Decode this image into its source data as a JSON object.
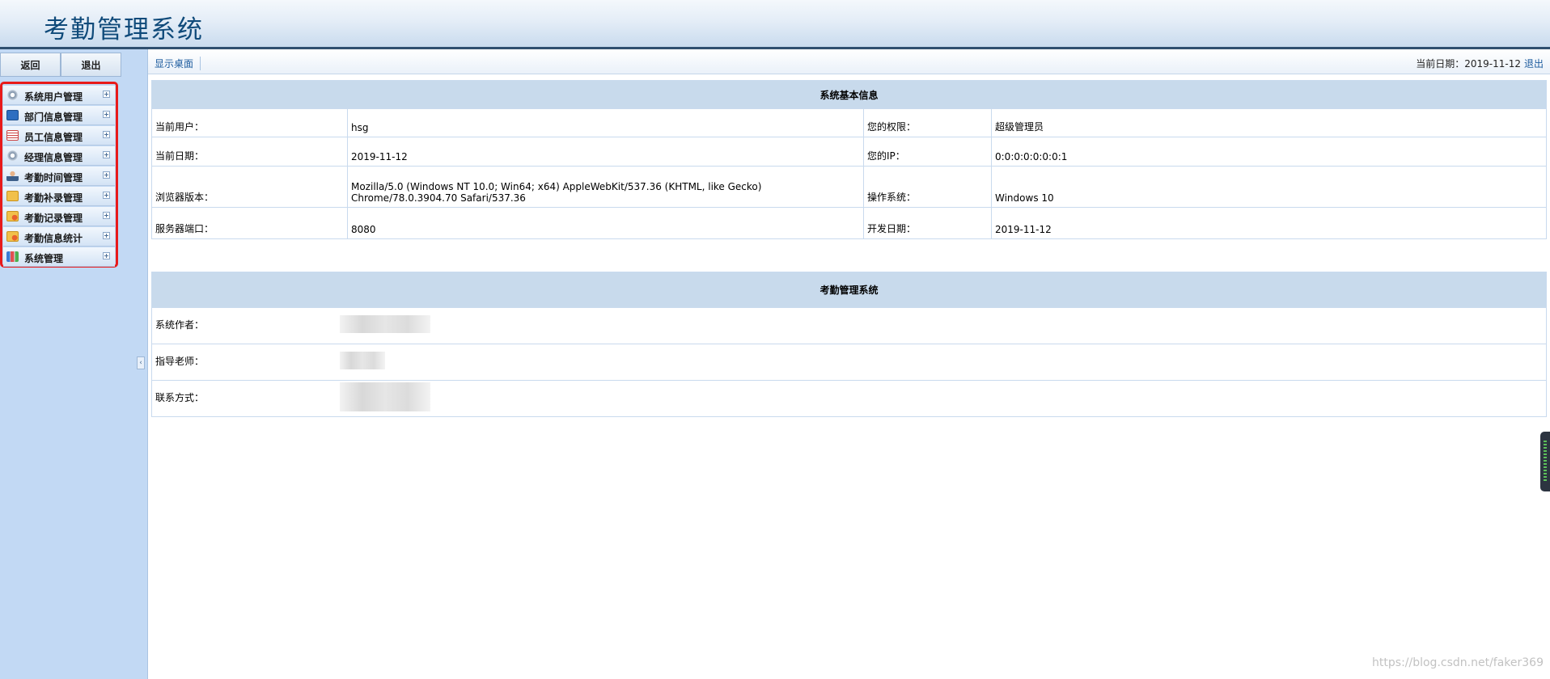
{
  "header": {
    "title": "考勤管理系统"
  },
  "sidebar": {
    "top_buttons": {
      "back": "返回",
      "exit": "退出"
    },
    "menu": [
      {
        "label": "系统用户管理",
        "icon": "gear-icon"
      },
      {
        "label": "部门信息管理",
        "icon": "monitor-icon"
      },
      {
        "label": "员工信息管理",
        "icon": "table-icon"
      },
      {
        "label": "经理信息管理",
        "icon": "gear-icon"
      },
      {
        "label": "考勤时间管理",
        "icon": "user-icon"
      },
      {
        "label": "考勤补录管理",
        "icon": "folder-icon"
      },
      {
        "label": "考勤记录管理",
        "icon": "folder-user-icon"
      },
      {
        "label": "考勤信息统计",
        "icon": "folder-user-icon"
      },
      {
        "label": "系统管理",
        "icon": "chart-icon"
      }
    ],
    "collapse_glyph": "‹"
  },
  "toolbar": {
    "desktop_link": "显示桌面",
    "date_label": "当前日期：2019-11-12",
    "logout": "退出"
  },
  "basic_info": {
    "title": "系统基本信息",
    "rows": [
      {
        "label1": "当前用户：",
        "value1": "hsg",
        "label2": "您的权限：",
        "value2": "超级管理员"
      },
      {
        "label1": "当前日期：",
        "value1": "2019-11-12",
        "label2": "您的IP：",
        "value2": "0:0:0:0:0:0:0:1"
      },
      {
        "label1": "浏览器版本：",
        "value1": "Mozilla/5.0 (Windows NT 10.0; Win64; x64) AppleWebKit/537.36 (KHTML, like Gecko) Chrome/78.0.3904.70 Safari/537.36",
        "label2": "操作系统：",
        "value2": "Windows 10"
      },
      {
        "label1": "服务器端口：",
        "value1": "8080",
        "label2": "开发日期：",
        "value2": "2019-11-12"
      }
    ]
  },
  "system_info": {
    "title": "考勤管理系统",
    "rows": [
      {
        "label": "系统作者："
      },
      {
        "label": "指导老师："
      },
      {
        "label": "联系方式："
      }
    ]
  },
  "watermark": "https://blog.csdn.net/faker369",
  "colors": {
    "menu_highlight_border": "#e81a1a",
    "header_text": "#0f4a7a",
    "link": "#1d5c9e"
  }
}
